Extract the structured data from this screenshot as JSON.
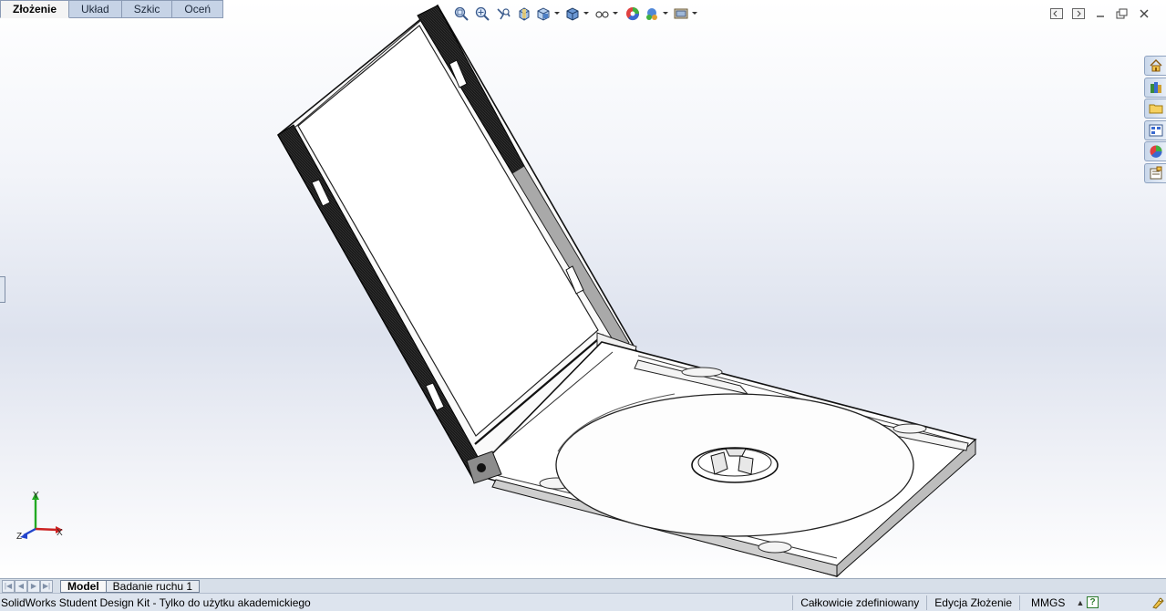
{
  "command_tabs": [
    {
      "label": "Złożenie",
      "active": true
    },
    {
      "label": "Układ",
      "active": false
    },
    {
      "label": "Szkic",
      "active": false
    },
    {
      "label": "Oceń",
      "active": false
    }
  ],
  "headsup_icons": [
    "zoom-to-fit-icon",
    "zoom-to-area-icon",
    "previous-view-icon",
    "section-view-icon",
    "view-orientation-icon",
    "display-style-icon",
    "hide-show-items-icon",
    "edit-appearance-icon",
    "apply-scene-icon",
    "view-settings-icon"
  ],
  "window_controls": [
    "tile-left-icon",
    "tile-right-icon",
    "minimize-icon",
    "restore-icon",
    "close-icon"
  ],
  "task_pane_icons": [
    "home-icon",
    "design-library-icon",
    "file-explorer-icon",
    "view-palette-icon",
    "appearances-icon",
    "custom-properties-icon"
  ],
  "triad": {
    "x": "X",
    "y": "Y",
    "z": "Z"
  },
  "bottom_tabs": {
    "nav_arrows": [
      "|◀",
      "◀",
      "▶",
      "▶|"
    ],
    "model": "Model",
    "motion_study": "Badanie ruchu 1"
  },
  "status_bar": {
    "message": "SolidWorks Student Design Kit - Tylko do użytku akademickiego",
    "definition_state": "Całkowicie zdefiniowany",
    "edit_state": "Edycja Złożenie",
    "units": "MMGS",
    "units_caret": "▲",
    "help": "?"
  },
  "colors": {
    "tab_bg": "#c6d3e6",
    "taskpane_bg": "#c9d7ea",
    "statusbar_bg": "#dde4ee",
    "axis_x": "#cc2222",
    "axis_y": "#22aa22",
    "axis_z": "#2244cc"
  }
}
